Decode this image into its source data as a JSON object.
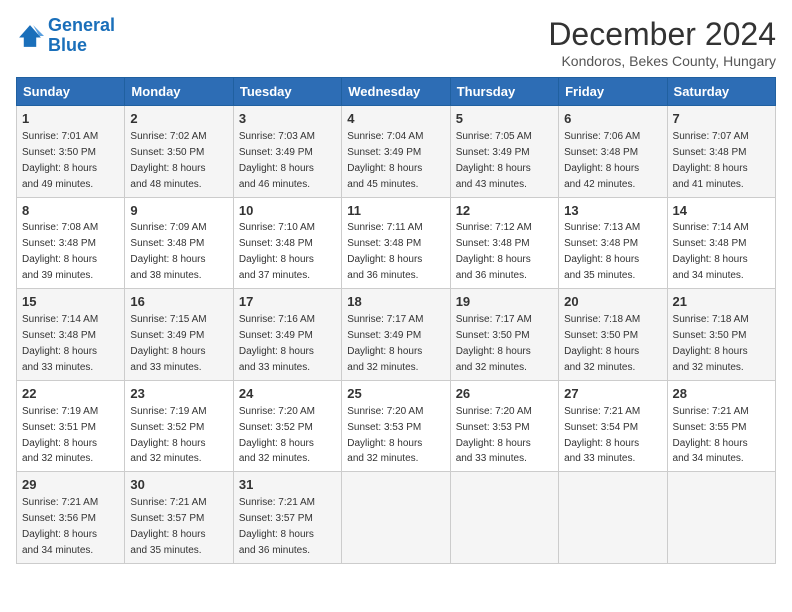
{
  "logo": {
    "line1": "General",
    "line2": "Blue"
  },
  "title": "December 2024",
  "subtitle": "Kondoros, Bekes County, Hungary",
  "columns": [
    "Sunday",
    "Monday",
    "Tuesday",
    "Wednesday",
    "Thursday",
    "Friday",
    "Saturday"
  ],
  "weeks": [
    [
      {
        "day": "1",
        "info": "Sunrise: 7:01 AM\nSunset: 3:50 PM\nDaylight: 8 hours\nand 49 minutes."
      },
      {
        "day": "2",
        "info": "Sunrise: 7:02 AM\nSunset: 3:50 PM\nDaylight: 8 hours\nand 48 minutes."
      },
      {
        "day": "3",
        "info": "Sunrise: 7:03 AM\nSunset: 3:49 PM\nDaylight: 8 hours\nand 46 minutes."
      },
      {
        "day": "4",
        "info": "Sunrise: 7:04 AM\nSunset: 3:49 PM\nDaylight: 8 hours\nand 45 minutes."
      },
      {
        "day": "5",
        "info": "Sunrise: 7:05 AM\nSunset: 3:49 PM\nDaylight: 8 hours\nand 43 minutes."
      },
      {
        "day": "6",
        "info": "Sunrise: 7:06 AM\nSunset: 3:48 PM\nDaylight: 8 hours\nand 42 minutes."
      },
      {
        "day": "7",
        "info": "Sunrise: 7:07 AM\nSunset: 3:48 PM\nDaylight: 8 hours\nand 41 minutes."
      }
    ],
    [
      {
        "day": "8",
        "info": "Sunrise: 7:08 AM\nSunset: 3:48 PM\nDaylight: 8 hours\nand 39 minutes."
      },
      {
        "day": "9",
        "info": "Sunrise: 7:09 AM\nSunset: 3:48 PM\nDaylight: 8 hours\nand 38 minutes."
      },
      {
        "day": "10",
        "info": "Sunrise: 7:10 AM\nSunset: 3:48 PM\nDaylight: 8 hours\nand 37 minutes."
      },
      {
        "day": "11",
        "info": "Sunrise: 7:11 AM\nSunset: 3:48 PM\nDaylight: 8 hours\nand 36 minutes."
      },
      {
        "day": "12",
        "info": "Sunrise: 7:12 AM\nSunset: 3:48 PM\nDaylight: 8 hours\nand 36 minutes."
      },
      {
        "day": "13",
        "info": "Sunrise: 7:13 AM\nSunset: 3:48 PM\nDaylight: 8 hours\nand 35 minutes."
      },
      {
        "day": "14",
        "info": "Sunrise: 7:14 AM\nSunset: 3:48 PM\nDaylight: 8 hours\nand 34 minutes."
      }
    ],
    [
      {
        "day": "15",
        "info": "Sunrise: 7:14 AM\nSunset: 3:48 PM\nDaylight: 8 hours\nand 33 minutes."
      },
      {
        "day": "16",
        "info": "Sunrise: 7:15 AM\nSunset: 3:49 PM\nDaylight: 8 hours\nand 33 minutes."
      },
      {
        "day": "17",
        "info": "Sunrise: 7:16 AM\nSunset: 3:49 PM\nDaylight: 8 hours\nand 33 minutes."
      },
      {
        "day": "18",
        "info": "Sunrise: 7:17 AM\nSunset: 3:49 PM\nDaylight: 8 hours\nand 32 minutes."
      },
      {
        "day": "19",
        "info": "Sunrise: 7:17 AM\nSunset: 3:50 PM\nDaylight: 8 hours\nand 32 minutes."
      },
      {
        "day": "20",
        "info": "Sunrise: 7:18 AM\nSunset: 3:50 PM\nDaylight: 8 hours\nand 32 minutes."
      },
      {
        "day": "21",
        "info": "Sunrise: 7:18 AM\nSunset: 3:50 PM\nDaylight: 8 hours\nand 32 minutes."
      }
    ],
    [
      {
        "day": "22",
        "info": "Sunrise: 7:19 AM\nSunset: 3:51 PM\nDaylight: 8 hours\nand 32 minutes."
      },
      {
        "day": "23",
        "info": "Sunrise: 7:19 AM\nSunset: 3:52 PM\nDaylight: 8 hours\nand 32 minutes."
      },
      {
        "day": "24",
        "info": "Sunrise: 7:20 AM\nSunset: 3:52 PM\nDaylight: 8 hours\nand 32 minutes."
      },
      {
        "day": "25",
        "info": "Sunrise: 7:20 AM\nSunset: 3:53 PM\nDaylight: 8 hours\nand 32 minutes."
      },
      {
        "day": "26",
        "info": "Sunrise: 7:20 AM\nSunset: 3:53 PM\nDaylight: 8 hours\nand 33 minutes."
      },
      {
        "day": "27",
        "info": "Sunrise: 7:21 AM\nSunset: 3:54 PM\nDaylight: 8 hours\nand 33 minutes."
      },
      {
        "day": "28",
        "info": "Sunrise: 7:21 AM\nSunset: 3:55 PM\nDaylight: 8 hours\nand 34 minutes."
      }
    ],
    [
      {
        "day": "29",
        "info": "Sunrise: 7:21 AM\nSunset: 3:56 PM\nDaylight: 8 hours\nand 34 minutes."
      },
      {
        "day": "30",
        "info": "Sunrise: 7:21 AM\nSunset: 3:57 PM\nDaylight: 8 hours\nand 35 minutes."
      },
      {
        "day": "31",
        "info": "Sunrise: 7:21 AM\nSunset: 3:57 PM\nDaylight: 8 hours\nand 36 minutes."
      },
      null,
      null,
      null,
      null
    ]
  ]
}
